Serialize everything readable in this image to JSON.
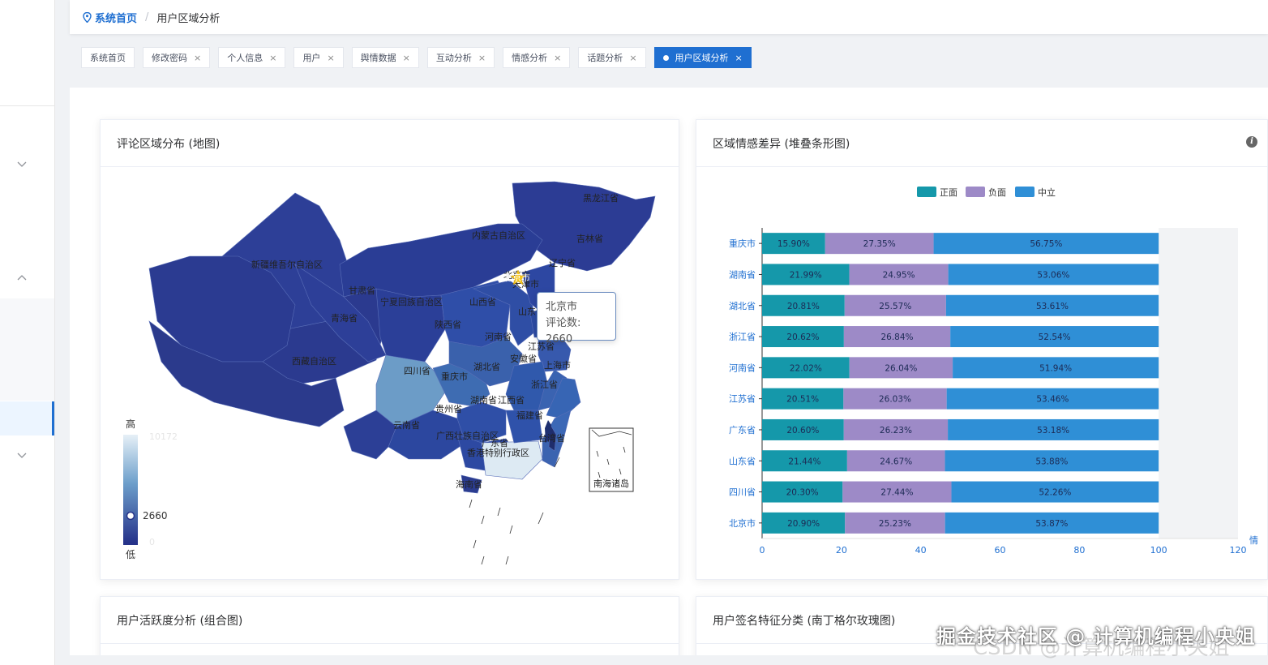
{
  "breadcrumb": {
    "home": "系统首页",
    "separator": "/",
    "current": "用户区域分析"
  },
  "tabs": [
    {
      "label": "系统首页",
      "closable": false,
      "active": false
    },
    {
      "label": "修改密码",
      "closable": true,
      "active": false
    },
    {
      "label": "个人信息",
      "closable": true,
      "active": false
    },
    {
      "label": "用户",
      "closable": true,
      "active": false
    },
    {
      "label": "舆情数据",
      "closable": true,
      "active": false
    },
    {
      "label": "互动分析",
      "closable": true,
      "active": false
    },
    {
      "label": "情感分析",
      "closable": true,
      "active": false
    },
    {
      "label": "话题分析",
      "closable": true,
      "active": false
    },
    {
      "label": "用户区域分析",
      "closable": true,
      "active": true
    }
  ],
  "tab_close_glyph": "×",
  "cards": {
    "map": {
      "title": "评论区域分布 (地图)"
    },
    "bar": {
      "title": "区域情感差异 (堆叠条形图)"
    },
    "activity": {
      "title": "用户活跃度分析 (组合图)"
    },
    "signature": {
      "title": "用户签名特征分类 (南丁格尔玫瑰图)"
    }
  },
  "map": {
    "visual_map": {
      "high_label": "高",
      "low_label": "低",
      "max_value": "10172",
      "min_value": "0",
      "current_value": "2660"
    },
    "tooltip": {
      "region": "北京市",
      "metric_line": "评论数: 2660"
    },
    "region_labels": [
      "黑龙江省",
      "吉林省",
      "辽宁省",
      "内蒙古自治区",
      "新疆维吾尔自治区",
      "甘肃省",
      "宁夏回族自治区",
      "山西省",
      "北京市",
      "天津市",
      "山东省",
      "陕西省",
      "河南省",
      "青海省",
      "西藏自治区",
      "四川省",
      "重庆市",
      "湖北省",
      "安徽省",
      "江苏省",
      "上海市",
      "浙江省",
      "湖南省",
      "江西省",
      "贵州省",
      "云南省",
      "广西壮族自治区",
      "广东省",
      "福建省",
      "台湾省",
      "海南省",
      "香港特别行政区"
    ],
    "inset_label": "南海诸岛"
  },
  "chart_data": {
    "type": "bar",
    "orientation": "horizontal",
    "stacked": true,
    "categories": [
      "重庆市",
      "湖南省",
      "湖北省",
      "浙江省",
      "河南省",
      "江苏省",
      "广东省",
      "山东省",
      "四川省",
      "北京市"
    ],
    "series": [
      {
        "name": "正面",
        "color": "#1598aa",
        "values": [
          15.9,
          21.99,
          20.81,
          20.62,
          22.02,
          20.51,
          20.6,
          21.44,
          20.3,
          20.9
        ]
      },
      {
        "name": "负面",
        "color": "#9d8ac7",
        "values": [
          27.35,
          24.95,
          25.57,
          26.84,
          26.04,
          26.03,
          26.23,
          24.67,
          27.44,
          25.23
        ]
      },
      {
        "name": "中立",
        "color": "#2f8fd6",
        "values": [
          56.75,
          53.06,
          53.61,
          52.54,
          51.94,
          53.46,
          53.18,
          53.88,
          52.26,
          53.87
        ]
      }
    ],
    "value_suffix": "%",
    "xlim": [
      0,
      120
    ],
    "xticks": [
      0,
      20,
      40,
      60,
      80,
      100,
      120
    ],
    "axis_label_fragment": "情",
    "legend_position": "top-center",
    "grid": false
  },
  "watermark": {
    "text": "掘金技术社区 @ 计算机编程小央姐",
    "ghost": "CSDN @计算机编程小央姐"
  }
}
